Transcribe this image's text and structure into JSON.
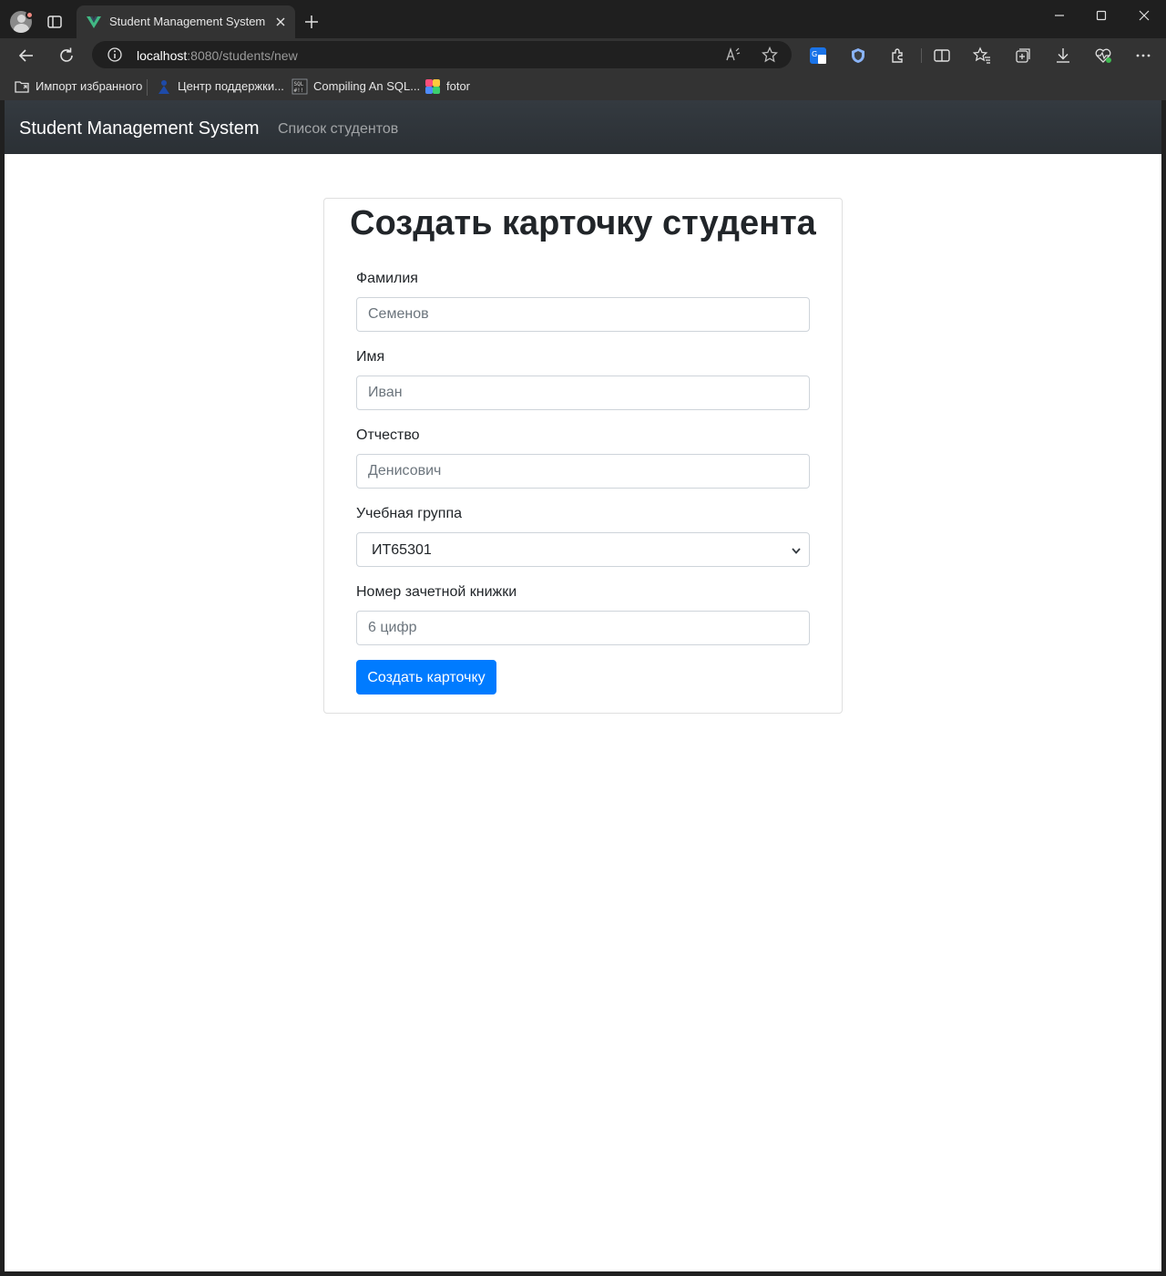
{
  "browser": {
    "tab": {
      "title": "Student Management System"
    },
    "address": {
      "host": "localhost",
      "rest": ":8080/students/new"
    },
    "bookmarks": [
      {
        "label": "Импорт избранного"
      },
      {
        "label": "Центр поддержки..."
      },
      {
        "label": "Compiling An SQL..."
      },
      {
        "label": "fotor"
      }
    ]
  },
  "navbar": {
    "brand": "Student Management System",
    "link": "Список студентов"
  },
  "form": {
    "title": "Создать карточку студента",
    "fields": [
      {
        "label": "Фамилия",
        "placeholder": "Семенов"
      },
      {
        "label": "Имя",
        "placeholder": "Иван"
      },
      {
        "label": "Отчество",
        "placeholder": "Денисович"
      },
      {
        "label": "Учебная группа",
        "selected": "ИТ65301"
      },
      {
        "label": "Номер зачетной книжки",
        "placeholder": "6 цифр"
      }
    ],
    "submit_label": "Создать карточку"
  },
  "colors": {
    "primary": "#007bff",
    "navbar": "#343a40",
    "vue_green": "#41b883"
  }
}
